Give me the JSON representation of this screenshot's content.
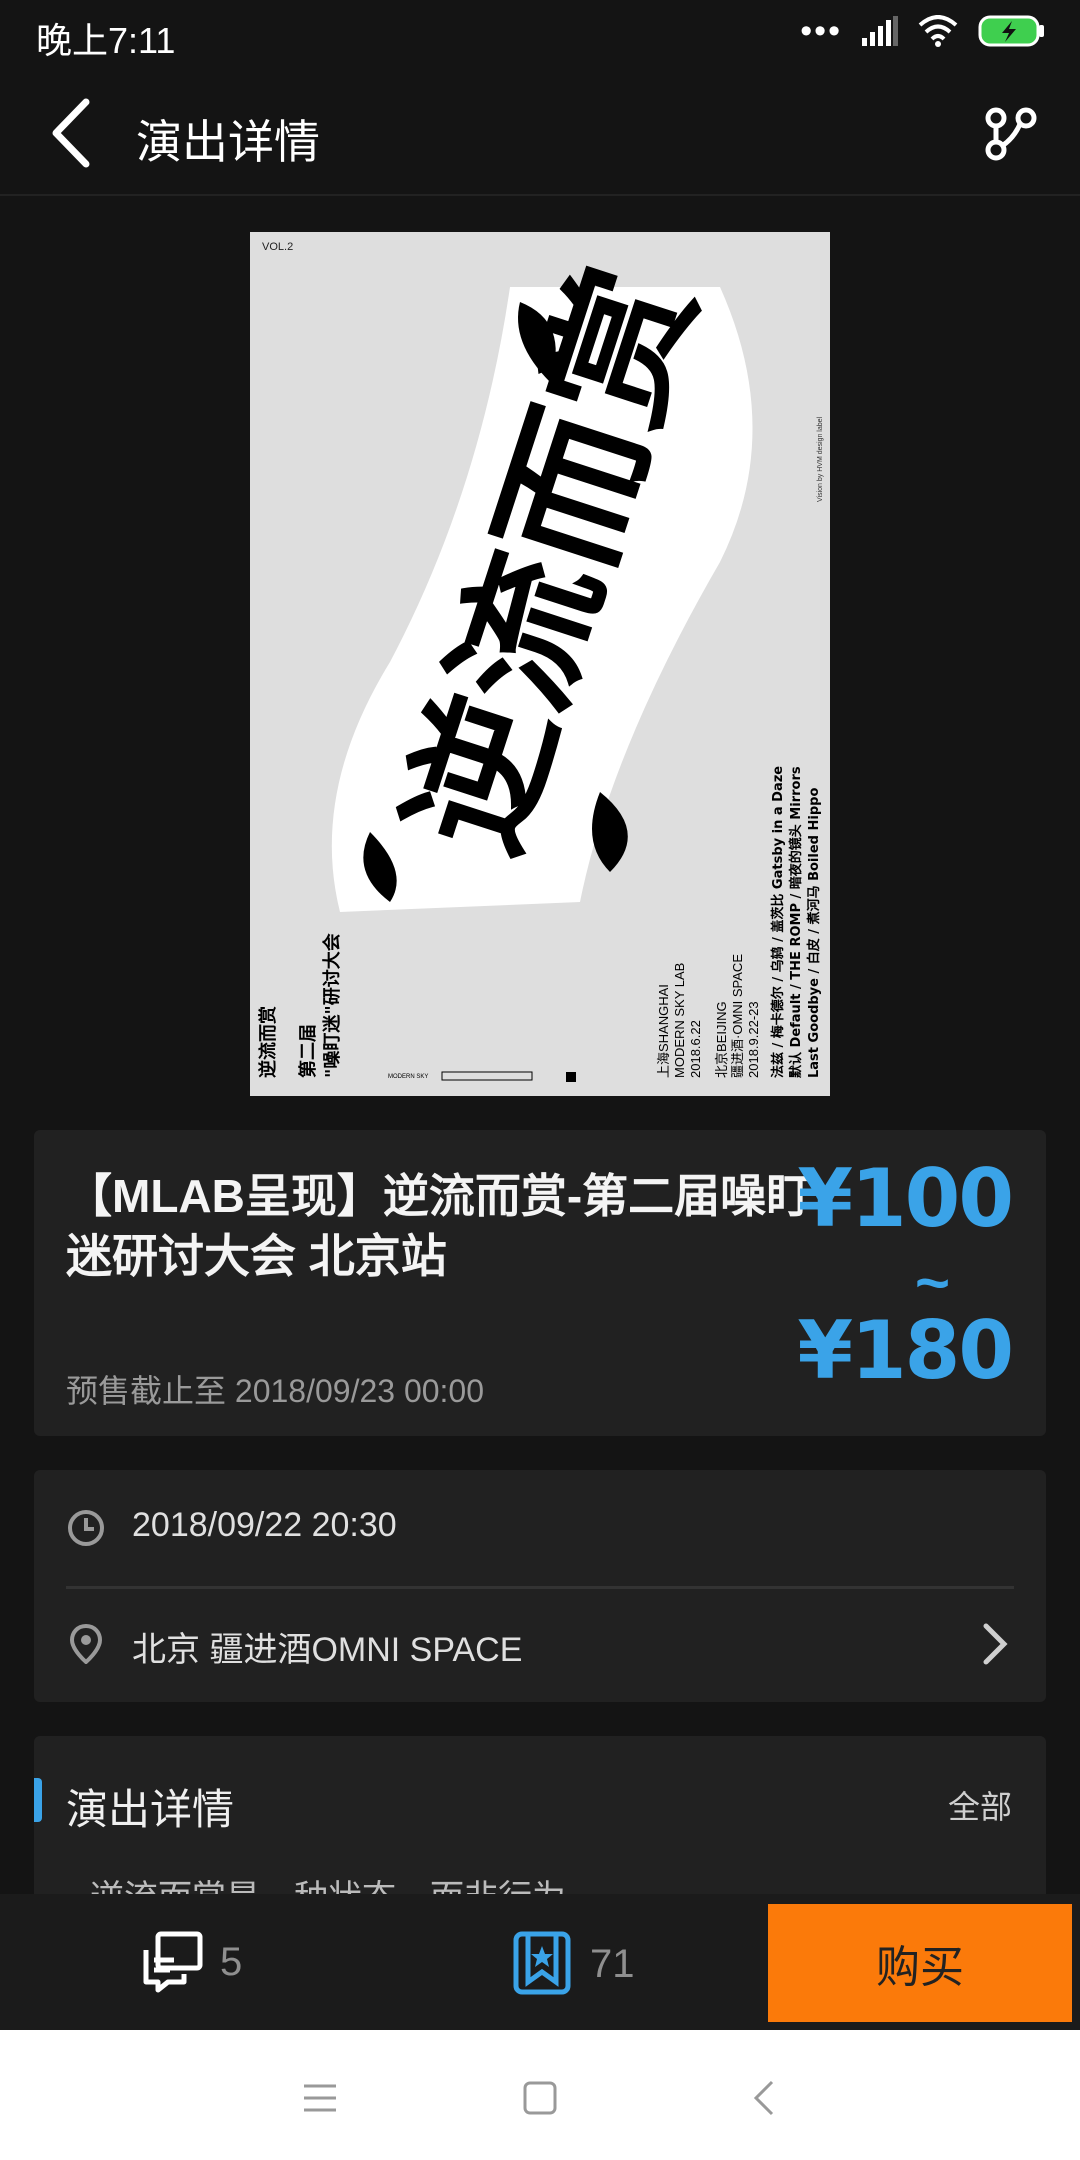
{
  "status_bar": {
    "time": "晚上7:11",
    "signal_dots": "•••",
    "icons": [
      "signal-icon",
      "wifi-icon",
      "battery-charging-icon"
    ]
  },
  "nav": {
    "title": "演出详情",
    "back_icon": "chevron-left-icon",
    "share_icon": "share-icon"
  },
  "poster": {
    "vol": "VOL.2",
    "big_text": "逆流而赏",
    "side_title_1": "逆流而赏",
    "side_title_2": "第二届",
    "side_title_3": "\"噪盯迷\"研讨大会",
    "venue_block": [
      "上海SHANGHAI",
      "MODERN SKY LAB",
      "2018.6.22",
      "北京BEIJING",
      "疆进酒·OMNI SPACE",
      "2018.9.22-23"
    ],
    "lineup": [
      "法兹 / 梅卡德尔 / 乌鸫 / 盖茨比 Gatsby in a Daze",
      "默认 Default / THE ROMP / 暗夜的镜头 Mirrors",
      "Last Goodbye / 白皮 / 煮河马 Boiled Hippo"
    ],
    "credit": "Vision by HVM design label",
    "logo_text": "MODERN SKY"
  },
  "event": {
    "title": "【MLAB呈现】逆流而赏-第二届噪盯迷研讨大会 北京站",
    "presale": "预售截止至 2018/09/23 00:00",
    "price_low": "¥100",
    "price_tilde": "~",
    "price_high": "¥180",
    "accent_color": "#3aa3e8"
  },
  "info": {
    "datetime": "2018/09/22 20:30",
    "venue": "北京 疆进酒OMNI SPACE"
  },
  "detail": {
    "title": "演出详情",
    "all_label": "全部",
    "preview_text": "逆流而赏是一种状态，而非行为"
  },
  "actions": {
    "comment_count": "5",
    "favorite_count": "71",
    "buy_label": "购买",
    "buy_color": "#fb7a0a"
  },
  "system_nav": {
    "icons": [
      "menu-icon",
      "home-icon",
      "back-icon"
    ]
  }
}
